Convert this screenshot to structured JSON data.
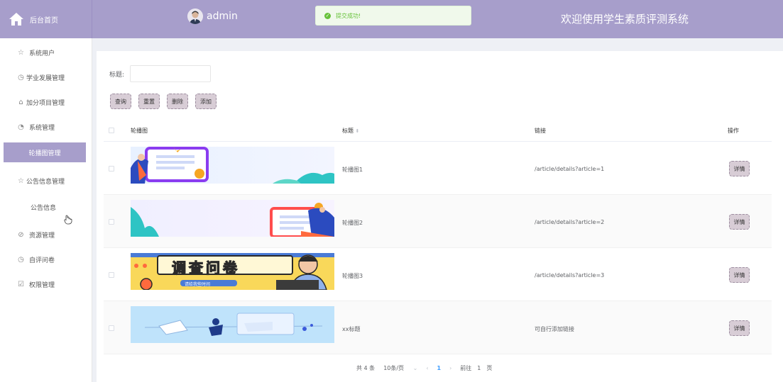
{
  "header": {
    "home_label": "后台首页",
    "username": "admin",
    "toast_message": "提交成功!",
    "site_title": "欢迎使用学生素质评测系统",
    "colors": {
      "header_bg": "#a79ecb",
      "toast_green": "#67c23a"
    }
  },
  "sidebar": {
    "items": [
      {
        "label": "系统用户",
        "icon": "star-icon"
      },
      {
        "label": "学业发展管理",
        "icon": "clock-icon"
      },
      {
        "label": "加分项目管理",
        "icon": "gift-icon"
      },
      {
        "label": "系统管理",
        "icon": "clock-icon"
      },
      {
        "label": "轮播图管理",
        "icon": ""
      },
      {
        "label": "公告信息管理",
        "icon": "star-icon"
      },
      {
        "label": "公告信息",
        "icon": ""
      },
      {
        "label": "资源管理",
        "icon": "compass-icon"
      },
      {
        "label": "自评问卷",
        "icon": "clock-icon"
      },
      {
        "label": "权限管理",
        "icon": "checkbox-icon"
      }
    ],
    "active_label": "轮播图管理"
  },
  "search": {
    "title_label": "标题:",
    "title_value": ""
  },
  "toolbar": {
    "query": "查询",
    "reset": "重置",
    "delete": "删除",
    "add": "添加"
  },
  "table": {
    "columns": {
      "image": "轮播图",
      "title": "标题",
      "link": "链接",
      "action": "操作"
    },
    "sort_icon": "sort-caret-icon",
    "rows": [
      {
        "title": "轮播图1",
        "link": "/article/details?article=1",
        "action": "详情",
        "banner_text": ""
      },
      {
        "title": "轮播图2",
        "link": "/article/details?article=2",
        "action": "详情",
        "banner_text": ""
      },
      {
        "title": "轮播图3",
        "link": "/article/details?article=3",
        "action": "详情",
        "banner_text": "调查问卷",
        "banner_subtext": "请给我些时间"
      },
      {
        "title": "xx标题",
        "link": "可自行添加链接",
        "action": "详情",
        "banner_text": ""
      }
    ]
  },
  "pagination": {
    "total": "共 4 条",
    "page_size": "10条/页",
    "current_page": "1",
    "goto_label": "前往",
    "goto_value": "1",
    "page_suffix": "页"
  }
}
